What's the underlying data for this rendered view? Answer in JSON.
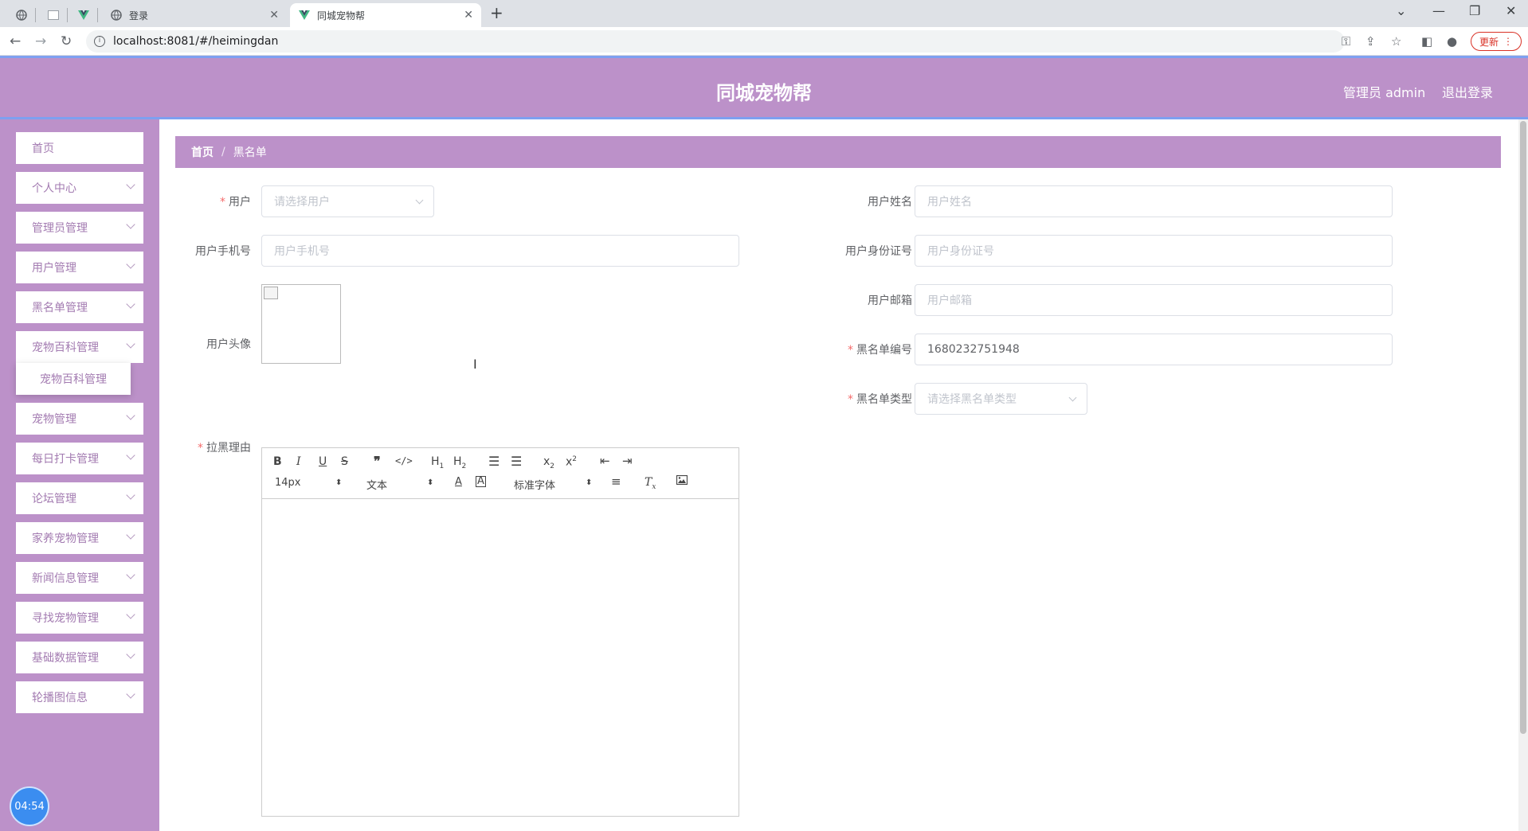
{
  "browser": {
    "tab1_title": "登录",
    "tab2_title": "同城宠物帮",
    "url": "localhost:8081/#/heimingdan",
    "update_label": "更新"
  },
  "header": {
    "title": "同城宠物帮",
    "admin_label": "管理员 admin",
    "logout_label": "退出登录"
  },
  "sidebar": {
    "items": [
      "首页",
      "个人中心",
      "管理员管理",
      "用户管理",
      "黑名单管理",
      "宠物百科管理",
      "宠物管理",
      "每日打卡管理",
      "论坛管理",
      "家养宠物管理",
      "新闻信息管理",
      "寻找宠物管理",
      "基础数据管理",
      "轮播图信息"
    ],
    "submenu_item": "宠物百科管理",
    "clock": "04:54"
  },
  "breadcrumb": {
    "home": "首页",
    "current": "黑名单"
  },
  "form": {
    "user_label": "用户",
    "user_placeholder": "请选择用户",
    "name_label": "用户姓名",
    "name_placeholder": "用户姓名",
    "phone_label": "用户手机号",
    "phone_placeholder": "用户手机号",
    "idcard_label": "用户身份证号",
    "idcard_placeholder": "用户身份证号",
    "email_label": "用户邮箱",
    "email_placeholder": "用户邮箱",
    "avatar_label": "用户头像",
    "blacklist_no_label": "黑名单编号",
    "blacklist_no_value": "1680232751948",
    "blacklist_type_label": "黑名单类型",
    "blacklist_type_placeholder": "请选择黑名单类型",
    "reason_label": "拉黑理由"
  },
  "editor": {
    "font_size": "14px",
    "paragraph": "文本",
    "font_family": "标准字体"
  },
  "colors": {
    "theme": "#bc91c9",
    "header_border": "#7ea0f0",
    "required": "#f56c6c"
  }
}
